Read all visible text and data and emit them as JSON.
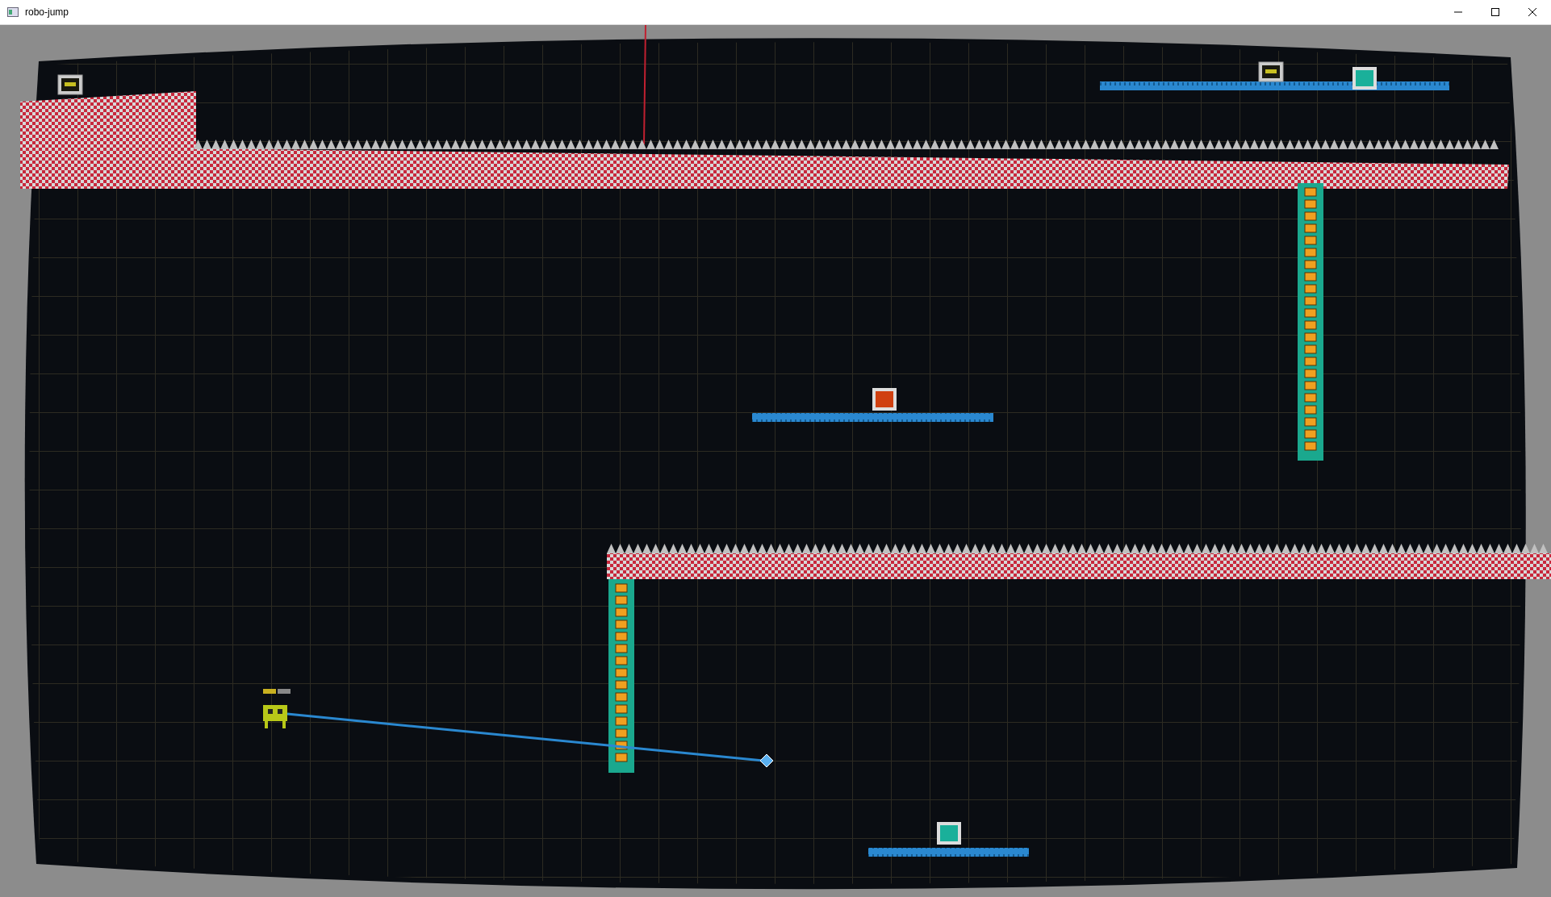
{
  "window": {
    "title": "robo-jump"
  }
}
